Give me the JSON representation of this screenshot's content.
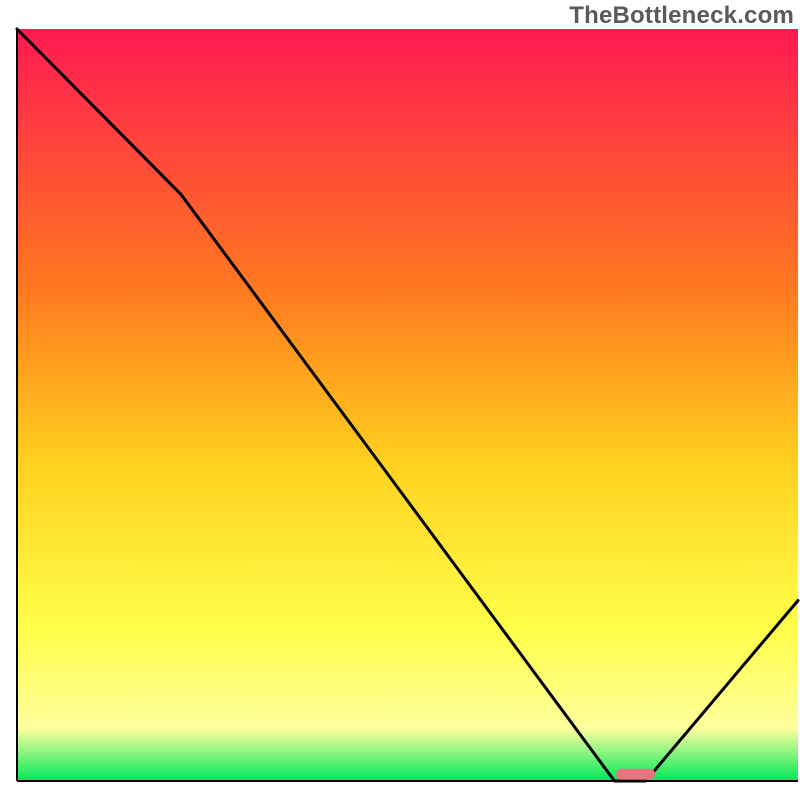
{
  "watermark": "TheBottleneck.com",
  "colors": {
    "gradient_top": "#ff1a52",
    "gradient_upper_mid": "#ff7a1f",
    "gradient_mid": "#ffd21f",
    "gradient_lower_mid": "#ffff4a",
    "gradient_low": "#ffff9e",
    "gradient_bottom": "#00e85a",
    "curve": "#000000",
    "marker": "#e9767f",
    "axis": "#000000"
  },
  "chart_data": {
    "type": "line",
    "title": "",
    "xlabel": "",
    "ylabel": "",
    "xlim": [
      0,
      100
    ],
    "ylim": [
      0,
      100
    ],
    "grid": false,
    "legend": false,
    "x": [
      0,
      21,
      76.5,
      80.5,
      100
    ],
    "values": [
      100,
      78,
      0,
      0,
      24
    ],
    "marker": {
      "x_start": 76.7,
      "x_end": 81.7,
      "y": 0.9
    },
    "notes": "x is normalized 0–100 across plot width; y is normalized 0–100 from bottom (0) to top (100). Curve is piecewise-linear approximation of visible black line. Marker is the small rounded pink bar at the trough."
  }
}
